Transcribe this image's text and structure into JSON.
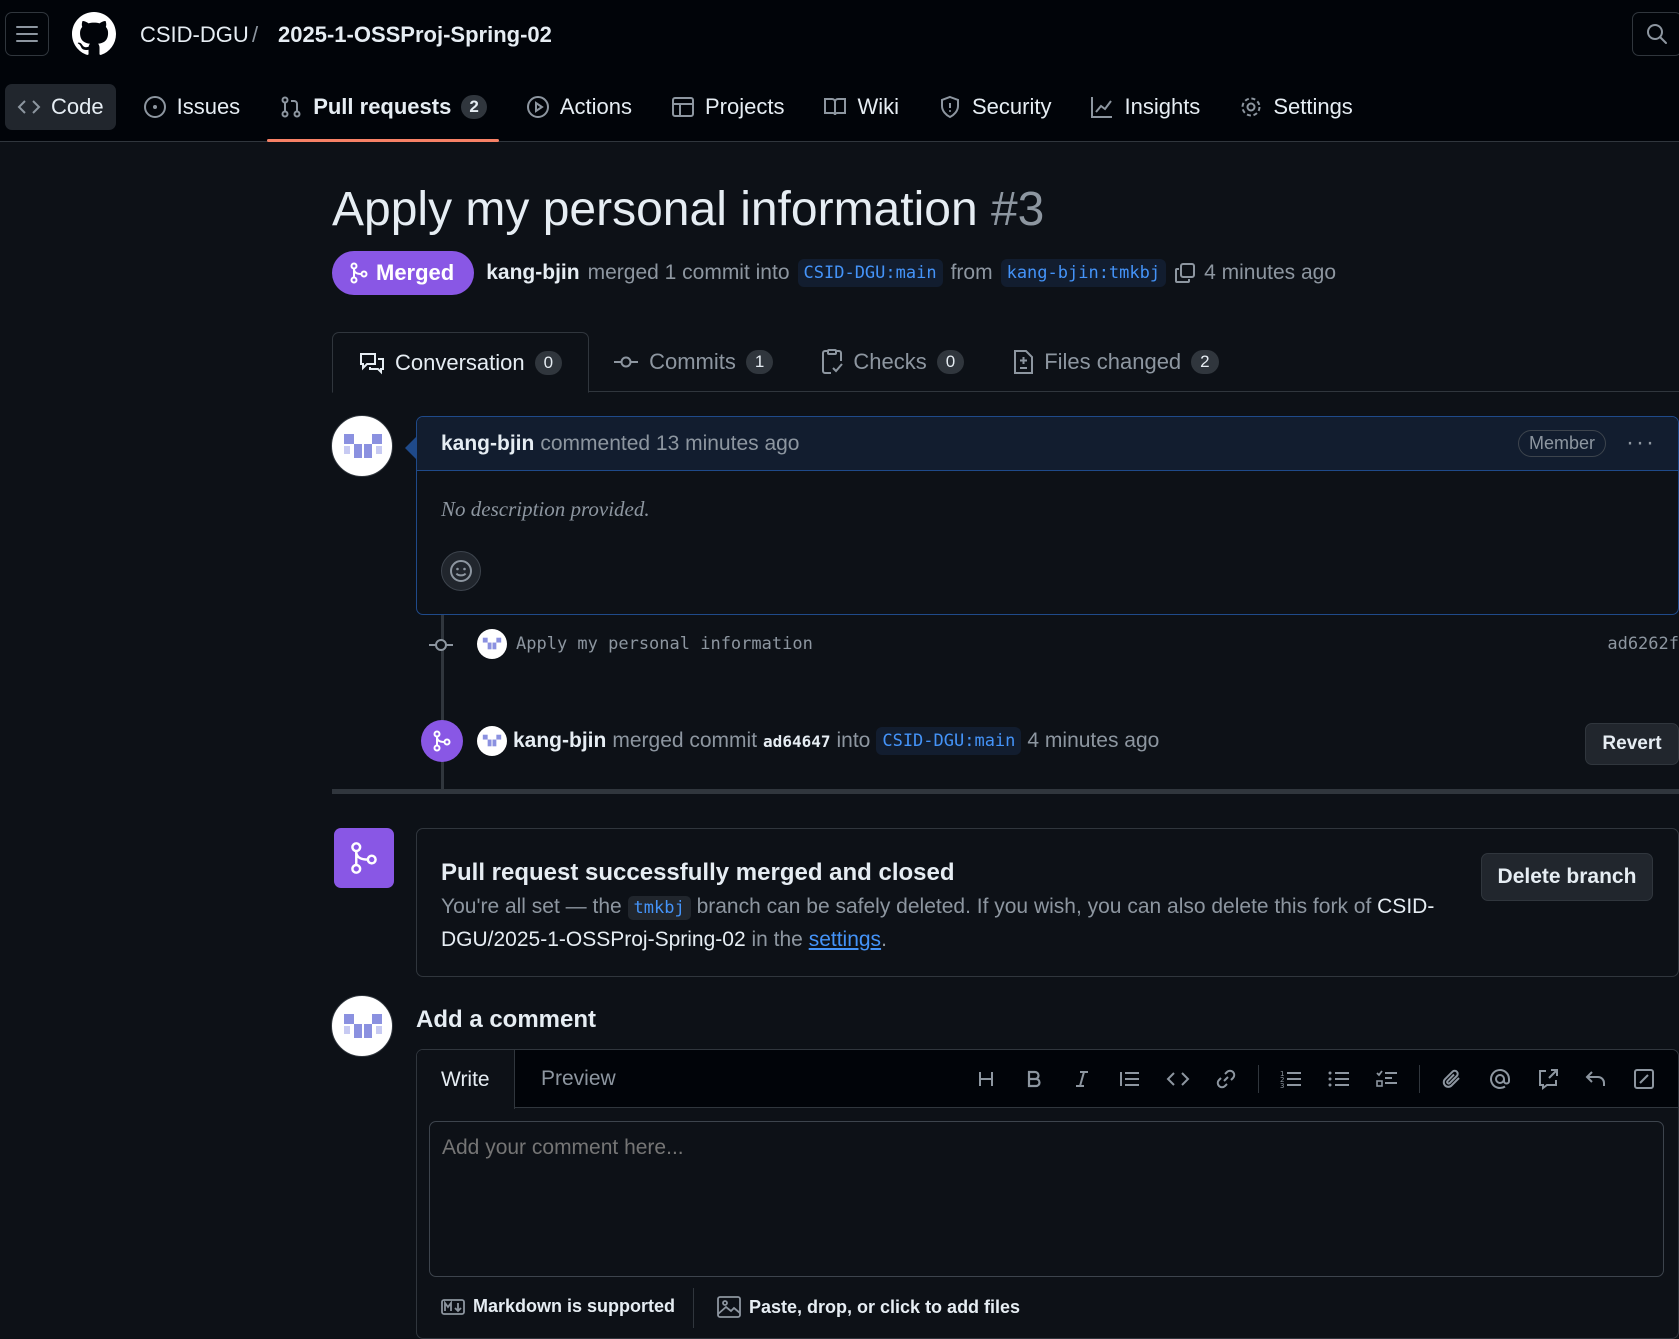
{
  "header": {
    "org": "CSID-DGU",
    "separator": "/",
    "repo": "2025-1-OSSProj-Spring-02"
  },
  "nav": {
    "code": "Code",
    "issues": "Issues",
    "pulls": "Pull requests",
    "pulls_count": "2",
    "actions": "Actions",
    "projects": "Projects",
    "wiki": "Wiki",
    "security": "Security",
    "insights": "Insights",
    "settings": "Settings"
  },
  "pr": {
    "title": "Apply my personal information",
    "number": "#3",
    "state": "Merged",
    "author": "kang-bjin",
    "merged_text": "merged 1 commit into",
    "base": "CSID-DGU:main",
    "from": "from",
    "head": "kang-bjin:tmkbj",
    "time": "4 minutes ago"
  },
  "tabs": {
    "conversation": "Conversation",
    "conversation_count": "0",
    "commits": "Commits",
    "commits_count": "1",
    "checks": "Checks",
    "checks_count": "0",
    "files": "Files changed",
    "files_count": "2"
  },
  "comment": {
    "author": "kang-bjin",
    "action": "commented 13 minutes ago",
    "role": "Member",
    "more": "···",
    "body": "No description provided."
  },
  "commit": {
    "message": "Apply my personal information",
    "sha": "ad6262f"
  },
  "merge_event": {
    "author": "kang-bjin",
    "text": "merged commit",
    "sha": "ad64647",
    "into": "into",
    "base": "CSID-DGU:main",
    "time": "4 minutes ago",
    "revert": "Revert"
  },
  "merged_box": {
    "title": "Pull request successfully merged and closed",
    "text1": "You're all set — the",
    "branch": "tmkbj",
    "text2": "branch can be safely deleted. If you wish, you can also delete this fork of",
    "repo_full": "CSID-DGU/2025-1-OSSProj-Spring-02",
    "text3": "in the",
    "settings_link": "settings",
    "period": ".",
    "delete_button": "Delete branch"
  },
  "add_comment": {
    "title": "Add a comment",
    "write_tab": "Write",
    "preview_tab": "Preview",
    "placeholder": "Add your comment here...",
    "markdown_note": "Markdown is supported",
    "attach_note": "Paste, drop, or click to add files"
  },
  "colors": {
    "merged": "#8957e5",
    "link": "#4493f8",
    "tab_underline": "#f78166",
    "background": "#0d1117"
  },
  "icons": [
    "hamburger-icon",
    "github-logo-icon",
    "search-icon",
    "code-icon",
    "issue-icon",
    "pull-request-icon",
    "play-icon",
    "table-icon",
    "book-icon",
    "shield-icon",
    "graph-icon",
    "gear-icon",
    "merge-icon",
    "copy-icon",
    "comment-icon",
    "commit-icon",
    "checklist-icon",
    "file-diff-icon",
    "smiley-icon"
  ]
}
